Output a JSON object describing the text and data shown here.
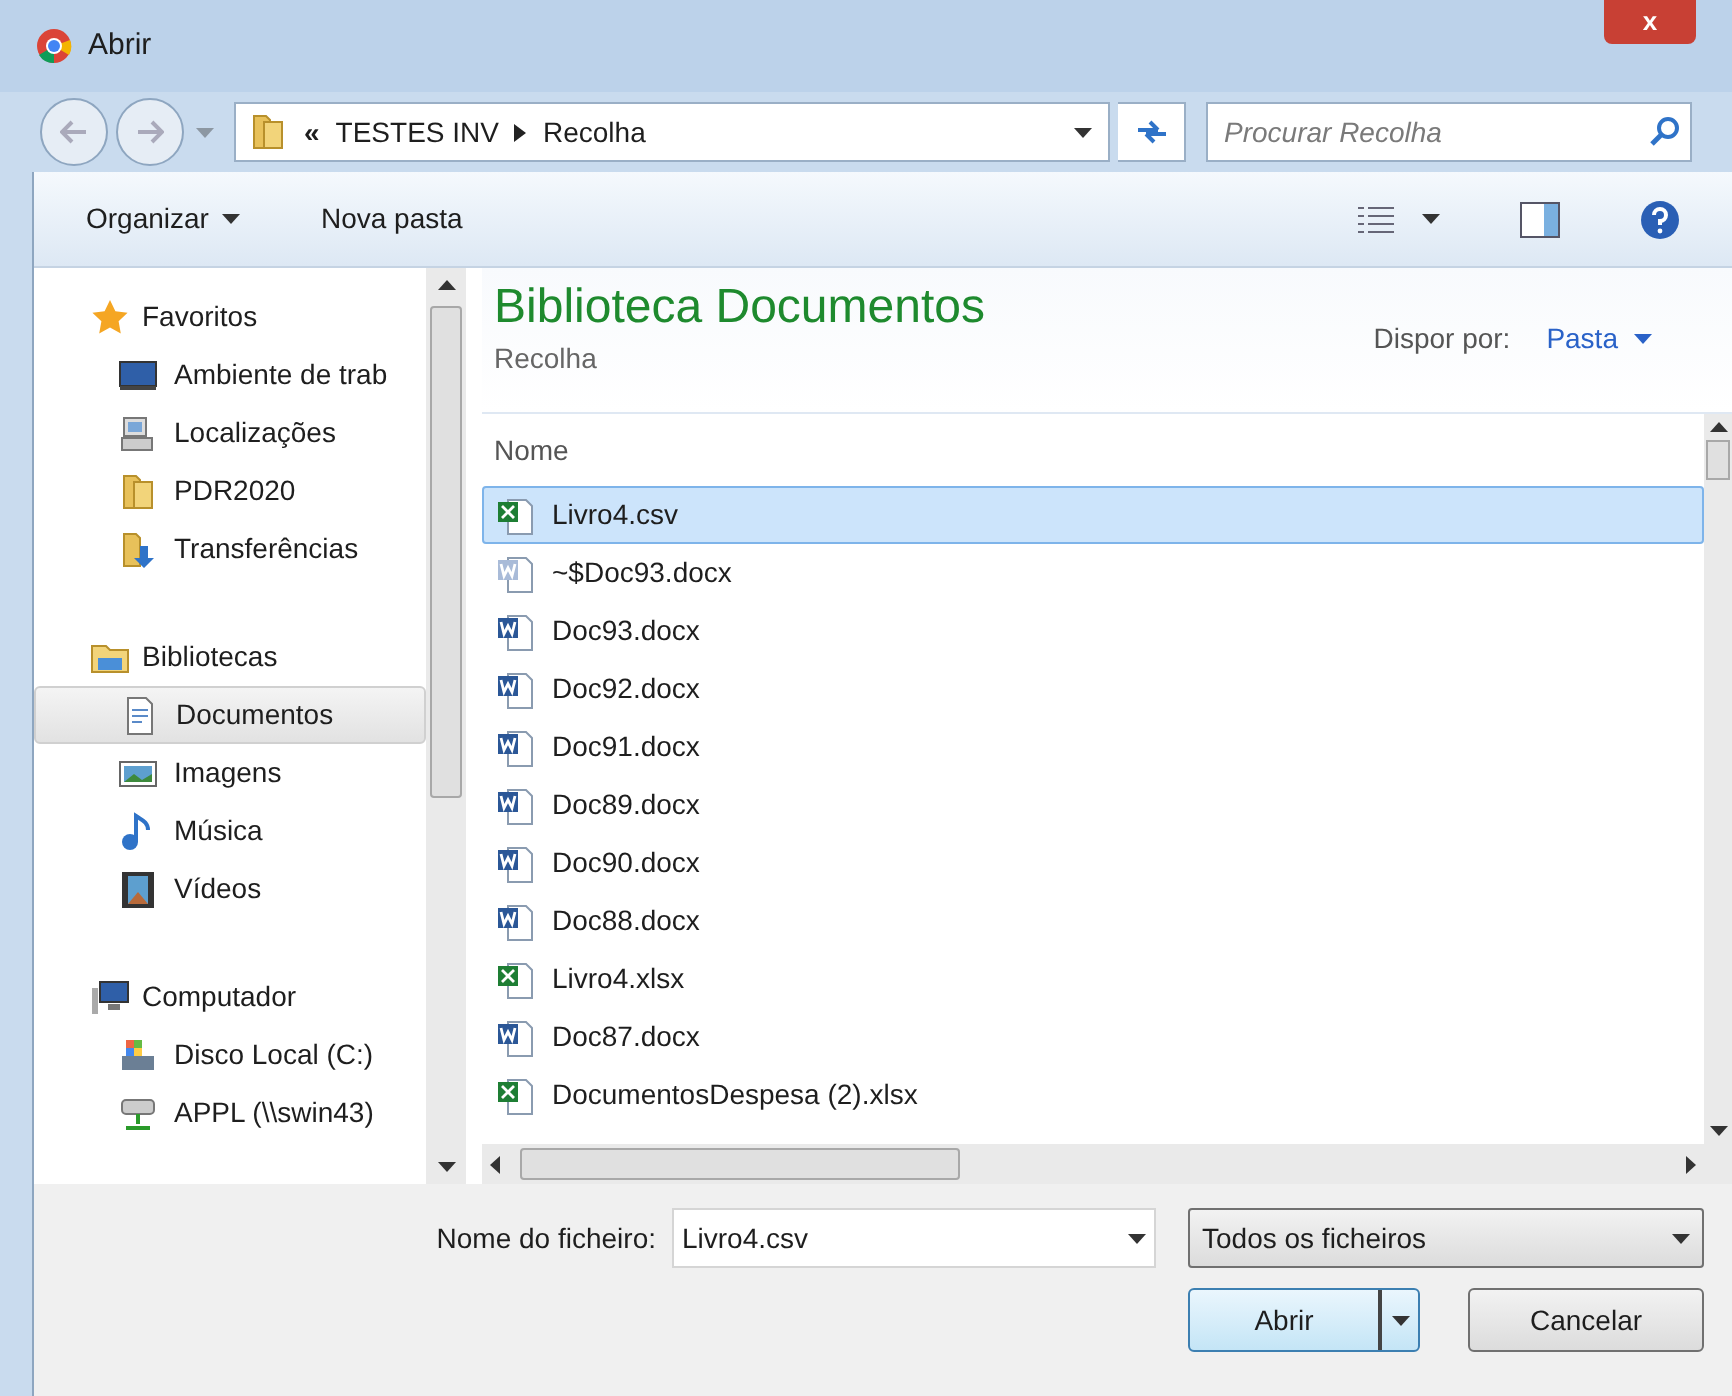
{
  "window": {
    "title": "Abrir",
    "close": "x"
  },
  "address": {
    "crumbs": [
      "TESTES INV",
      "Recolha"
    ],
    "overflow": "«"
  },
  "search": {
    "placeholder": "Procurar Recolha"
  },
  "toolbar": {
    "organize": "Organizar",
    "new_folder": "Nova pasta"
  },
  "sidebar": {
    "sections": [
      {
        "label": "Favoritos",
        "kind": "star",
        "children": [
          {
            "label": "Ambiente de trab",
            "kind": "desktop",
            "selected": false
          },
          {
            "label": "Localizações",
            "kind": "places",
            "selected": false
          },
          {
            "label": "PDR2020",
            "kind": "folder",
            "selected": false
          },
          {
            "label": "Transferências",
            "kind": "download",
            "selected": false
          }
        ]
      },
      {
        "label": "Bibliotecas",
        "kind": "library",
        "children": [
          {
            "label": "Documentos",
            "kind": "document",
            "selected": true
          },
          {
            "label": "Imagens",
            "kind": "picture",
            "selected": false
          },
          {
            "label": "Música",
            "kind": "music",
            "selected": false
          },
          {
            "label": "Vídeos",
            "kind": "video",
            "selected": false
          }
        ]
      },
      {
        "label": "Computador",
        "kind": "computer",
        "children": [
          {
            "label": "Disco Local (C:)",
            "kind": "disk",
            "selected": false
          },
          {
            "label": "APPL (\\\\swin43)",
            "kind": "network",
            "selected": false
          }
        ]
      }
    ]
  },
  "library": {
    "title": "Biblioteca Documentos",
    "subtitle": "Recolha",
    "arrange_label": "Dispor por:",
    "arrange_value": "Pasta"
  },
  "file_list": {
    "column": "Nome",
    "rows": [
      {
        "name": "Livro4.csv",
        "kind": "csv",
        "selected": true
      },
      {
        "name": "~$Doc93.docx",
        "kind": "word-temp",
        "selected": false
      },
      {
        "name": "Doc93.docx",
        "kind": "word",
        "selected": false
      },
      {
        "name": "Doc92.docx",
        "kind": "word",
        "selected": false
      },
      {
        "name": "Doc91.docx",
        "kind": "word",
        "selected": false
      },
      {
        "name": "Doc89.docx",
        "kind": "word",
        "selected": false
      },
      {
        "name": "Doc90.docx",
        "kind": "word",
        "selected": false
      },
      {
        "name": "Doc88.docx",
        "kind": "word",
        "selected": false
      },
      {
        "name": "Livro4.xlsx",
        "kind": "excel",
        "selected": false
      },
      {
        "name": "Doc87.docx",
        "kind": "word",
        "selected": false
      },
      {
        "name": "DocumentosDespesa (2).xlsx",
        "kind": "excel",
        "selected": false
      }
    ]
  },
  "footer": {
    "filename_label": "Nome do ficheiro:",
    "filename_value": "Livro4.csv",
    "filter": "Todos os ficheiros",
    "open": "Abrir",
    "cancel": "Cancelar"
  }
}
